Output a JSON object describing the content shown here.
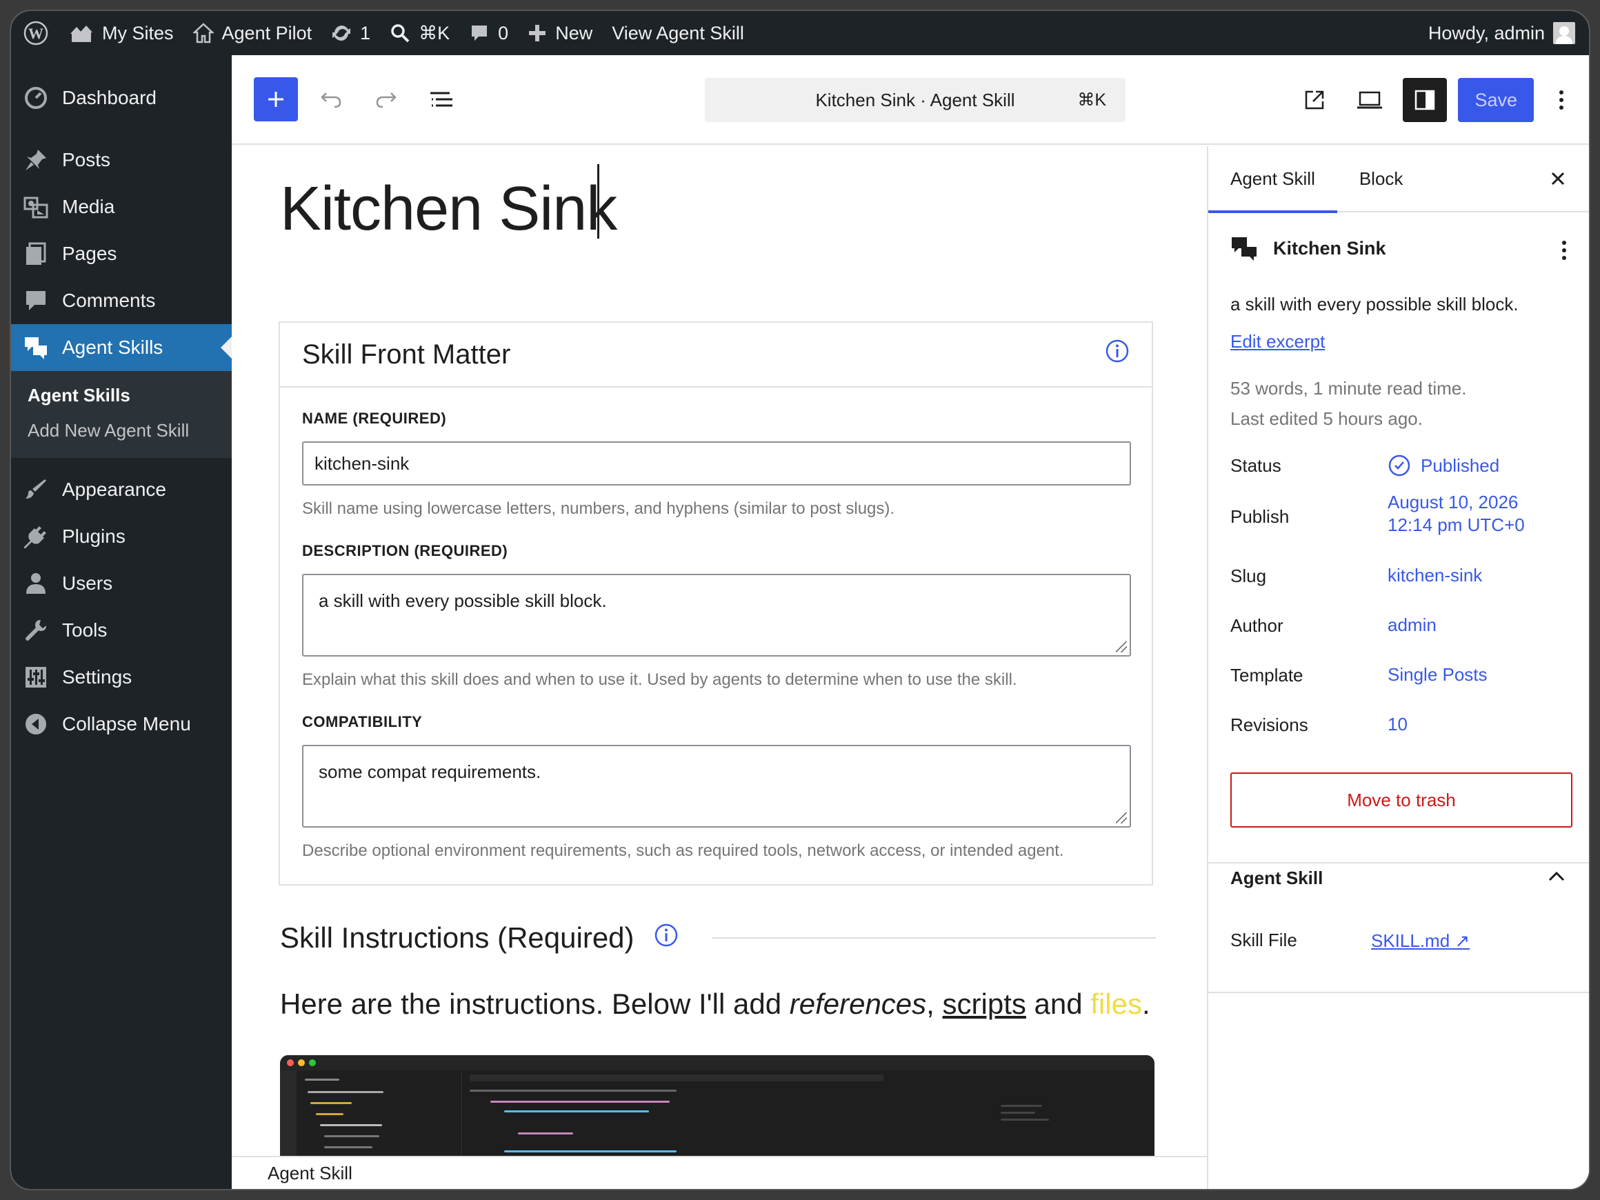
{
  "admin_bar": {
    "my_sites": "My Sites",
    "site_name": "Agent Pilot",
    "updates_count": "1",
    "search_shortcut": "⌘K",
    "comments_count": "0",
    "new_label": "New",
    "view_label": "View Agent Skill",
    "howdy": "Howdy, admin"
  },
  "sidebar": {
    "items": [
      {
        "label": "Dashboard",
        "icon": "dashboard-icon"
      },
      {
        "label": "Posts",
        "icon": "pin-icon"
      },
      {
        "label": "Media",
        "icon": "media-icon"
      },
      {
        "label": "Pages",
        "icon": "pages-icon"
      },
      {
        "label": "Comments",
        "icon": "comment-icon"
      },
      {
        "label": "Agent Skills",
        "icon": "chat-bubbles-icon"
      },
      {
        "label": "Appearance",
        "icon": "brush-icon"
      },
      {
        "label": "Plugins",
        "icon": "plug-icon"
      },
      {
        "label": "Users",
        "icon": "user-icon"
      },
      {
        "label": "Tools",
        "icon": "wrench-icon"
      },
      {
        "label": "Settings",
        "icon": "sliders-icon"
      },
      {
        "label": "Collapse Menu",
        "icon": "collapse-icon"
      }
    ],
    "submenu": [
      "Agent Skills",
      "Add New Agent Skill"
    ]
  },
  "toolbar": {
    "command_title": "Kitchen Sink · Agent Skill",
    "command_shortcut": "⌘K",
    "save_label": "Save"
  },
  "post": {
    "title": "Kitchen Sink"
  },
  "front_matter": {
    "heading": "Skill Front Matter",
    "name_label": "NAME (REQUIRED)",
    "name_value": "kitchen-sink",
    "name_help": "Skill name using lowercase letters, numbers, and hyphens (similar to post slugs).",
    "desc_label": "DESCRIPTION (REQUIRED)",
    "desc_value": "a skill with every possible skill block.",
    "desc_help": "Explain what this skill does and when to use it. Used by agents to determine when to use the skill.",
    "compat_label": "COMPATIBILITY",
    "compat_value": "some compat requirements.",
    "compat_help": "Describe optional environment requirements, such as required tools, network access, or intended agent."
  },
  "instructions": {
    "heading": "Skill Instructions (Required)",
    "p1": "Here are the ",
    "p2": "instructions",
    "p3": ". Below I'll add ",
    "p4": "references",
    "p5": ", ",
    "p6": "scripts",
    "p7": " and ",
    "p8": "files",
    "p9": "."
  },
  "footer": {
    "breadcrumb": "Agent Skill"
  },
  "inspector": {
    "tab_post": "Agent Skill",
    "tab_block": "Block",
    "title": "Kitchen Sink",
    "excerpt": "a skill with every possible skill block.",
    "edit_excerpt": "Edit excerpt",
    "stats": "53 words, 1 minute read time.",
    "last_edited": "Last edited 5 hours ago.",
    "status_label": "Status",
    "status_value": "Published",
    "publish_label": "Publish",
    "publish_date": "August 10, 2026",
    "publish_time": "12:14 pm UTC+0",
    "slug_label": "Slug",
    "slug_value": "kitchen-sink",
    "author_label": "Author",
    "author_value": "admin",
    "template_label": "Template",
    "template_value": "Single Posts",
    "revisions_label": "Revisions",
    "revisions_value": "10",
    "trash_label": "Move to trash",
    "panel_title": "Agent Skill",
    "skill_file_label": "Skill File",
    "skill_file_value": "SKILL.md ↗"
  },
  "colors": {
    "accent": "#3858e9",
    "admin_bg": "#1d2327",
    "active_menu": "#2271b1",
    "danger": "#cc1818"
  }
}
